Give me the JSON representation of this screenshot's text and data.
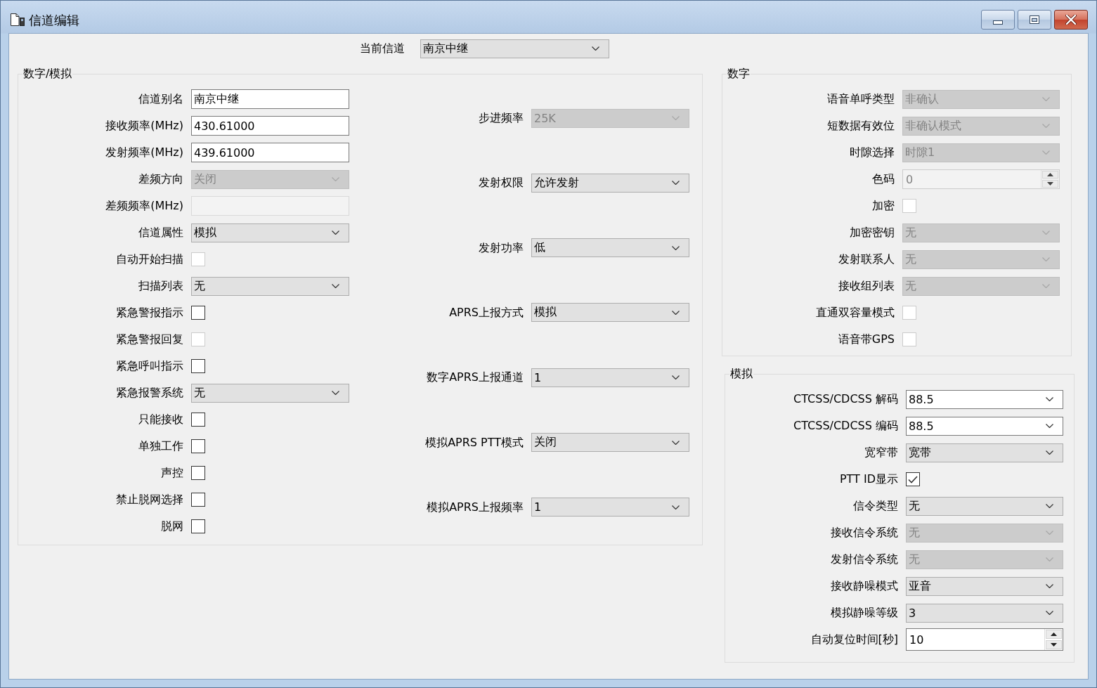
{
  "window": {
    "title": "信道编辑"
  },
  "current_channel": {
    "label": "当前信道",
    "value": "南京中继"
  },
  "groups": [
    {
      "title": "数字/模拟",
      "columns": [
        {
          "fields": [
            {
              "label": "信道别名",
              "kind": "text",
              "value": "南京中继",
              "disabled": false
            },
            {
              "label": "接收频率(MHz)",
              "kind": "text",
              "value": "430.61000",
              "disabled": false
            },
            {
              "label": "发射频率(MHz)",
              "kind": "text",
              "value": "439.61000",
              "disabled": false
            },
            {
              "label": "差频方向",
              "kind": "select",
              "value": "关闭",
              "disabled": true
            },
            {
              "label": "差频频率(MHz)",
              "kind": "text",
              "disabled": true
            },
            {
              "label": "信道属性",
              "kind": "select",
              "value": "模拟",
              "disabled": false
            },
            {
              "label": "自动开始扫描",
              "kind": "checkbox",
              "checked": false,
              "disabled": true
            },
            {
              "label": "扫描列表",
              "kind": "select",
              "value": "无",
              "disabled": false
            },
            {
              "label": "紧急警报指示",
              "kind": "checkbox",
              "checked": false,
              "disabled": false
            },
            {
              "label": "紧急警报回复",
              "kind": "checkbox",
              "checked": false,
              "disabled": true
            },
            {
              "label": "紧急呼叫指示",
              "kind": "checkbox",
              "checked": false,
              "disabled": false
            },
            {
              "label": "紧急报警系统",
              "kind": "select",
              "value": "无",
              "disabled": false
            },
            {
              "label": "只能接收",
              "kind": "checkbox",
              "checked": false,
              "disabled": false
            },
            {
              "label": "单独工作",
              "kind": "checkbox",
              "checked": false,
              "disabled": false
            },
            {
              "label": "声控",
              "kind": "checkbox",
              "checked": false,
              "disabled": false
            },
            {
              "label": "禁止脱网选择",
              "kind": "checkbox",
              "checked": false,
              "disabled": false
            },
            {
              "label": "脱网",
              "kind": "checkbox",
              "checked": false,
              "disabled": false
            }
          ]
        },
        {
          "fields": [
            {
              "label": "步进频率",
              "kind": "select",
              "value": "25K",
              "disabled": true
            },
            {
              "label": "发射权限",
              "kind": "select",
              "value": "允许发射",
              "disabled": false
            },
            {
              "label": "发射功率",
              "kind": "select",
              "value": "低",
              "disabled": false
            },
            {
              "label": "APRS上报方式",
              "kind": "select",
              "value": "模拟",
              "disabled": false
            },
            {
              "label": "数字APRS上报通道",
              "kind": "select",
              "value": "1",
              "disabled": false
            },
            {
              "label": "模拟APRS PTT模式",
              "kind": "select",
              "value": "关闭",
              "disabled": false
            },
            {
              "label": "模拟APRS上报频率",
              "kind": "select",
              "value": "1",
              "disabled": false
            }
          ]
        }
      ]
    },
    {
      "title": "数字",
      "columns": [
        {
          "fields": [
            {
              "label": "语音单呼类型",
              "kind": "select",
              "value": "非确认",
              "disabled": true
            },
            {
              "label": "短数据有效位",
              "kind": "select",
              "value": "非确认模式",
              "disabled": true
            },
            {
              "label": "时隙选择",
              "kind": "select",
              "value": "时隙1",
              "disabled": true
            },
            {
              "label": "色码",
              "kind": "spin",
              "value": "0",
              "disabled": true
            },
            {
              "label": "加密",
              "kind": "checkbox",
              "checked": false,
              "disabled": true
            },
            {
              "label": "加密密钥",
              "kind": "select",
              "value": "无",
              "disabled": true
            },
            {
              "label": "发射联系人",
              "kind": "select",
              "value": "无",
              "disabled": true
            },
            {
              "label": "接收组列表",
              "kind": "select",
              "value": "无",
              "disabled": true
            },
            {
              "label": "直通双容量模式",
              "kind": "checkbox",
              "checked": false,
              "disabled": true
            },
            {
              "label": "语音带GPS",
              "kind": "checkbox",
              "checked": false,
              "disabled": true
            }
          ]
        }
      ]
    },
    {
      "title": "模拟",
      "columns": [
        {
          "fields": [
            {
              "label": "CTCSS/CDCSS 解码",
              "kind": "combo",
              "value": "88.5",
              "disabled": false
            },
            {
              "label": "CTCSS/CDCSS 编码",
              "kind": "combo",
              "value": "88.5",
              "disabled": false
            },
            {
              "label": "宽窄带",
              "kind": "select",
              "value": "宽带",
              "disabled": false
            },
            {
              "label": "PTT ID显示",
              "kind": "checkbox",
              "checked": true,
              "disabled": false
            },
            {
              "label": "信令类型",
              "kind": "select",
              "value": "无",
              "disabled": false
            },
            {
              "label": "接收信令系统",
              "kind": "select",
              "value": "无",
              "disabled": true
            },
            {
              "label": "发射信令系统",
              "kind": "select",
              "value": "无",
              "disabled": true
            },
            {
              "label": "接收静噪模式",
              "kind": "select",
              "value": "亚音",
              "disabled": false
            },
            {
              "label": "模拟静噪等级",
              "kind": "select",
              "value": "3",
              "disabled": false
            },
            {
              "label": "自动复位时间[秒]",
              "kind": "spin",
              "value": "10",
              "disabled": false
            }
          ]
        }
      ]
    }
  ]
}
